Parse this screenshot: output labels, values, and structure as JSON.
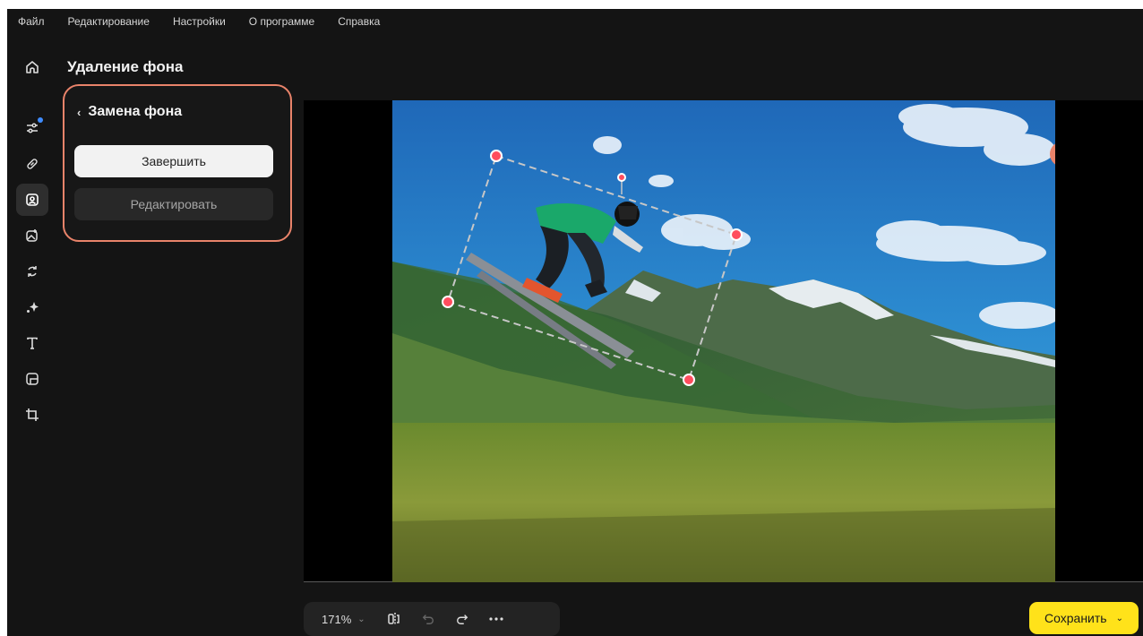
{
  "menu": [
    "Файл",
    "Редактирование",
    "Настройки",
    "О программе",
    "Справка"
  ],
  "page_title": "Удаление фона",
  "panel": {
    "title": "Замена фона",
    "finish_label": "Завершить",
    "edit_label": "Редактировать"
  },
  "toolbar": {
    "zoom": "171%"
  },
  "save_label": "Сохранить",
  "colors": {
    "accent": "#ffe21a",
    "highlight": "#e9836a",
    "handle": "#ff4d5e",
    "badge": "#3f8cff"
  },
  "tools": [
    "adjust-icon",
    "retouch-icon",
    "portrait-icon",
    "replace-bg-icon",
    "transform-icon",
    "effects-icon",
    "text-icon",
    "frame-icon",
    "crop-icon"
  ]
}
